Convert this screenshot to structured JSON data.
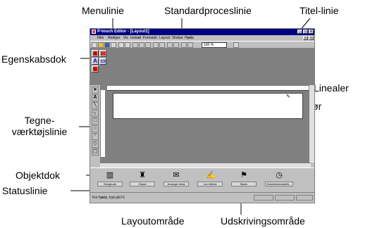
{
  "labels": {
    "menulinie": "Menulinie",
    "standardproceslinie": "Standardproceslinie",
    "titel_linie": "Titel-linie",
    "egenskabsdok": "Egenskabsdok",
    "linealer": "Linealer",
    "markor": "Markør",
    "tegne_line1": "Tegne-",
    "tegne_line2": "værktøjslinie",
    "objektdok": "Objektdok",
    "statuslinie": "Statuslinie",
    "layoutomraade": "Layoutområde",
    "udskrivningsomraade": "Udskrivingsområde"
  },
  "window": {
    "title": "P-touch Editor - [Layout1]",
    "menu": [
      "Filer",
      "Rediger",
      "Vis",
      "Indsæt",
      "Formatér",
      "Layout",
      "Vindue",
      "Hjælp"
    ],
    "zoom": "100 %",
    "status": "For hjælp, tryk på F1"
  },
  "object_dock": [
    "Stregkode",
    "Clipart",
    "Arranger tekst",
    "Lav billede",
    "Blank",
    "Dato/klokkeslæt/k..."
  ],
  "colors": {
    "titlebar": "#000080",
    "workspace": "#808080",
    "chrome": "#c0c0c0"
  }
}
